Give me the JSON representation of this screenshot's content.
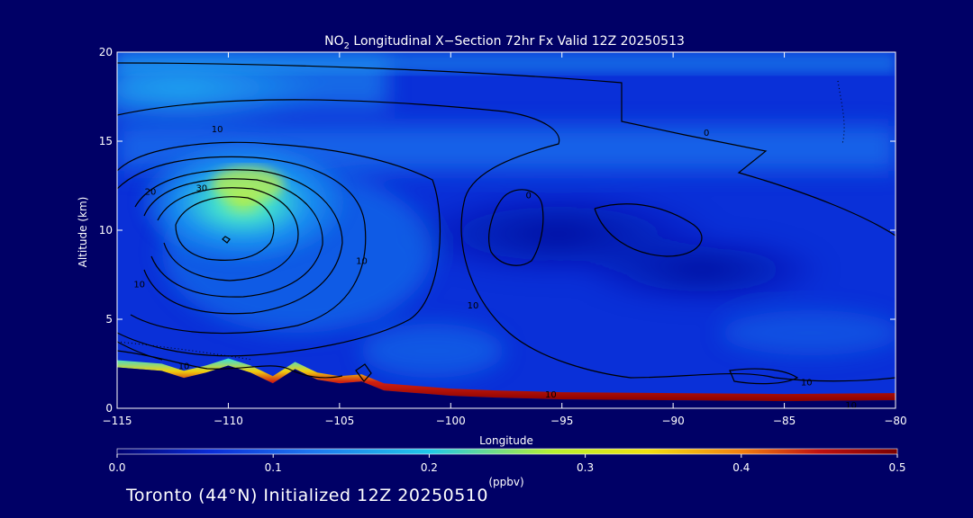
{
  "chart_data": {
    "type": "heatmap",
    "title": {
      "species": "NO",
      "subscript": "2",
      "rest": " Longitudinal X−Section 72hr  Fx Valid 12Z 20250513"
    },
    "xlabel": "Longitude",
    "ylabel": "Altitude (km)",
    "xlim": [
      -115,
      -80
    ],
    "ylim": [
      0,
      20
    ],
    "x_ticks": [
      -115,
      -110,
      -105,
      -100,
      -95,
      -90,
      -85,
      -80
    ],
    "x_tick_labels": [
      "−115",
      "−110",
      "−105",
      "−100",
      "−95",
      "−90",
      "−85",
      "−80"
    ],
    "y_ticks": [
      0,
      5,
      10,
      15,
      20
    ],
    "y_tick_labels": [
      "0",
      "5",
      "10",
      "15",
      "20"
    ],
    "colorbar": {
      "min": 0.0,
      "max": 0.5,
      "ticks": [
        0.0,
        0.1,
        0.2,
        0.3,
        0.4,
        0.5
      ],
      "tick_labels": [
        "0.0",
        "0.1",
        "0.2",
        "0.3",
        "0.4",
        "0.5"
      ],
      "unit": "(ppbv)",
      "colors": [
        "#000070",
        "#0a2cd8",
        "#1e78f0",
        "#20c8e8",
        "#b8f030",
        "#f0e010",
        "#f08010",
        "#c01010",
        "#7a0000"
      ]
    },
    "field_features": [
      {
        "feature": "upper plume",
        "lon": -110,
        "alt": 12,
        "value": 0.25
      },
      {
        "feature": "upper band",
        "lon_range": [
          -115,
          -80
        ],
        "alt": 14,
        "value": 0.12
      },
      {
        "feature": "free troposphere",
        "lon_range": [
          -102,
          -80
        ],
        "alt": 7,
        "value": 0.05
      },
      {
        "feature": "surface layer",
        "lon_range": [
          -115,
          -80
        ],
        "alt": 0.5,
        "value": 0.5
      }
    ],
    "terrain": [
      [
        -115,
        2.3
      ],
      [
        -113,
        2.1
      ],
      [
        -112,
        1.7
      ],
      [
        -111,
        2.0
      ],
      [
        -110,
        2.4
      ],
      [
        -109,
        2.0
      ],
      [
        -108,
        1.4
      ],
      [
        -107,
        2.2
      ],
      [
        -106,
        1.6
      ],
      [
        -105,
        1.4
      ],
      [
        -104,
        1.5
      ],
      [
        -103,
        1.0
      ],
      [
        -102,
        0.9
      ],
      [
        -100,
        0.7
      ],
      [
        -98,
        0.6
      ],
      [
        -95,
        0.5
      ],
      [
        -90,
        0.45
      ],
      [
        -85,
        0.4
      ],
      [
        -80,
        0.45
      ]
    ],
    "contour_labels": [
      {
        "text": "10",
        "lon": -110.5,
        "alt": 15.7
      },
      {
        "text": "20",
        "lon": -113.5,
        "alt": 12.2
      },
      {
        "text": "30",
        "lon": -111.2,
        "alt": 12.4
      },
      {
        "text": "0",
        "lon": -88.5,
        "alt": 15.5
      },
      {
        "text": "0",
        "lon": -96.5,
        "alt": 12.0
      },
      {
        "text": "10",
        "lon": -104.0,
        "alt": 8.3
      },
      {
        "text": "10",
        "lon": -99.0,
        "alt": 5.8
      },
      {
        "text": "10",
        "lon": -114.0,
        "alt": 7.0
      },
      {
        "text": "10",
        "lon": -112.0,
        "alt": 2.4
      },
      {
        "text": "10",
        "lon": -95.5,
        "alt": 0.8
      },
      {
        "text": "10",
        "lon": -84.0,
        "alt": 1.5
      },
      {
        "text": "10",
        "lon": -82.0,
        "alt": 0.2
      }
    ]
  },
  "footer": "Toronto (44°N) Initialized 12Z 20250510"
}
